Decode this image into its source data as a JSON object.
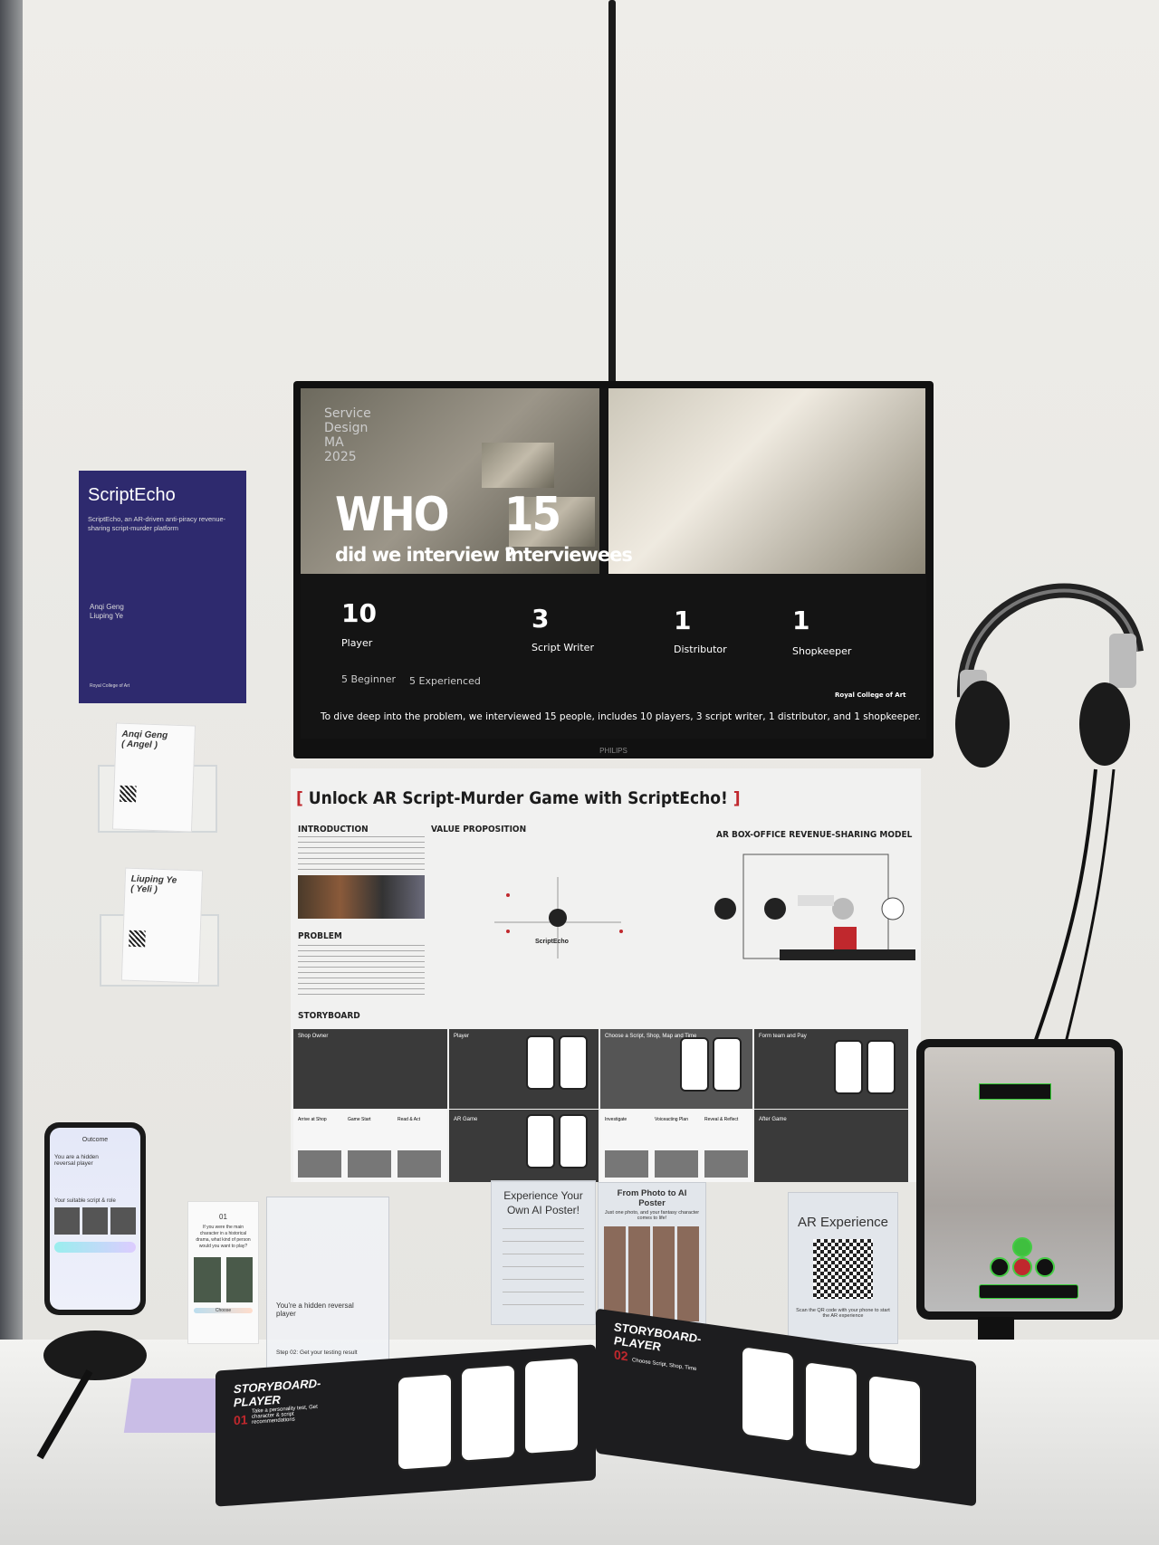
{
  "monitor": {
    "program": "Service Design MA 2025",
    "headline_who": "WHO",
    "headline_question": "did we interview ?",
    "count_total": "15",
    "count_label": "Interviewees",
    "groups": [
      {
        "count": "10",
        "label": "Player"
      },
      {
        "count": "3",
        "label": "Script Writer"
      },
      {
        "count": "1",
        "label": "Distributor"
      },
      {
        "count": "1",
        "label": "Shopkeeper"
      }
    ],
    "player_split": [
      "5 Beginner",
      "5 Experienced"
    ],
    "summary": "To dive deep into the problem, we interviewed 15 people, includes 10 players, 3 script writer, 1 distributor, and 1 shopkeeper.",
    "logo": "Royal College of Art",
    "brand": "PHILIPS"
  },
  "poster": {
    "title": "ScriptEcho",
    "subtitle": "ScriptEcho, an AR-driven anti-piracy revenue-sharing script-murder platform",
    "authors": [
      "Anqi Geng",
      "Liuping Ye"
    ],
    "logo": "Royal College of Art"
  },
  "cards": [
    {
      "name": "Anqi Geng",
      "nick": "( Angel )"
    },
    {
      "name": "Liuping Ye",
      "nick": "( Yeli )"
    }
  ],
  "banner": {
    "title": "Unlock AR Script-Murder Game with ScriptEcho!",
    "sections": [
      "INTRODUCTION",
      "VALUE PROPOSITION",
      "AR BOX-OFFICE REVENUE-SHARING MODEL",
      "PROBLEM",
      "STORYBOARD"
    ],
    "center_label": "ScriptEcho",
    "storyboard": [
      "Shop Owner",
      "Player",
      "Choose a Script, Shop, Map and Time",
      "Form team and Pay",
      "Arrive at Shop",
      "Game Start",
      "Read & Act",
      "AR Game",
      "Investigate",
      "Voiceacting Plan",
      "Reveal & Reflect",
      "After Game"
    ]
  },
  "phone": {
    "title": "Outcome",
    "result": "You are a hidden reversal player",
    "section": "Your suitable script & role"
  },
  "quiz_card": {
    "number": "01",
    "question": "If you were the main character in a historical drama, what kind of person would you want to play?",
    "button": "Choose"
  },
  "stand": {
    "result": "You're a hidden reversal player",
    "step": "Step 02: Get your testing result"
  },
  "signs": {
    "ai_poster": "Experience Your Own AI Poster!",
    "photo_poster_title": "From Photo to AI Poster",
    "photo_poster_sub": "Just one photo, and your fantasy character comes to life!",
    "ar_title": "AR Experience",
    "ar_sub": "Scan the QR code with your phone to start the AR experience"
  },
  "book": {
    "left_title": "STORYBOARD-PLAYER",
    "left_step": "01",
    "left_desc": "Take a personality test, Get character & script recommendations",
    "right_title": "STORYBOARD-PLAYER",
    "right_step": "02",
    "right_desc": "Choose Script, Shop, Time"
  },
  "colors": {
    "poster": "#2e2a6e",
    "accent_red": "#c0282d",
    "ar_green": "#3fbf3f"
  }
}
